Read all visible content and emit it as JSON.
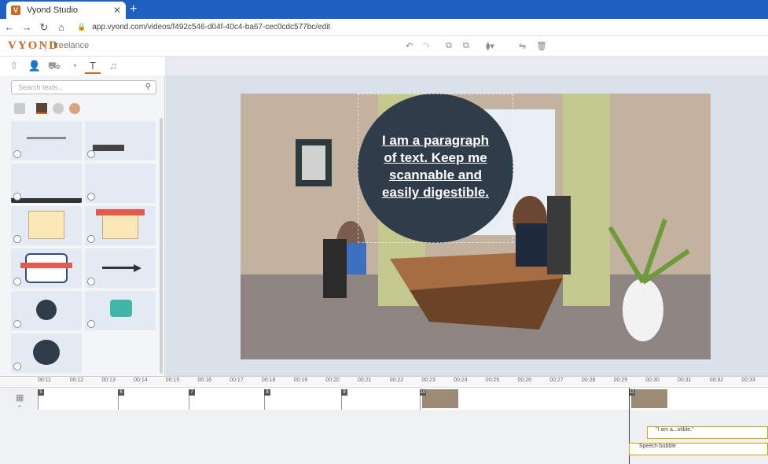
{
  "browser": {
    "tab_title": "Vyond Studio",
    "url": "app.vyond.com/videos/f492c546-d04f-40c4-ba67-cec0cdc577bc/edit"
  },
  "app": {
    "logo": "VYOND",
    "project": "freelance"
  },
  "left_panel": {
    "search_placeholder": "Search texts..."
  },
  "canvas": {
    "bubble_text": "I am a paragraph of text. Keep me scannable and easily digestible."
  },
  "timeline": {
    "ruler_labels": [
      "00:11",
      "00:12",
      "00:13",
      "00:14",
      "00:15",
      "00:16",
      "00:17",
      "00:18",
      "00:19",
      "00:20",
      "00:21",
      "00:22",
      "00:23",
      "00:24",
      "00:25",
      "00:26",
      "00:27",
      "00:28",
      "00:29",
      "00:30",
      "00:31",
      "00:32",
      "00:33"
    ],
    "scenes": [
      "5",
      "6",
      "7",
      "8",
      "9",
      "10",
      "11"
    ],
    "bars": [
      {
        "label": "\"I am a...stible.\""
      },
      {
        "label": "Speech bubble"
      }
    ]
  }
}
